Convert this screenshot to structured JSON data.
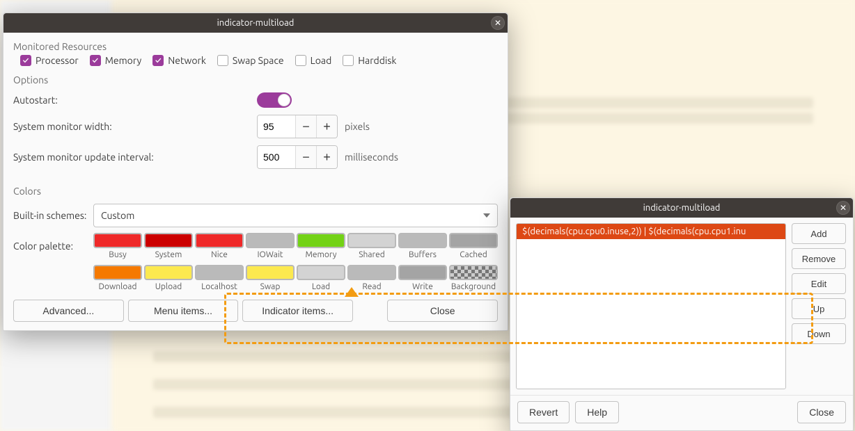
{
  "dialog1": {
    "title": "indicator-multiload",
    "sections": {
      "monitored": "Monitored Resources",
      "options": "Options",
      "colors": "Colors"
    },
    "checkboxes": [
      {
        "label": "Processor",
        "checked": true
      },
      {
        "label": "Memory",
        "checked": true
      },
      {
        "label": "Network",
        "checked": true
      },
      {
        "label": "Swap Space",
        "checked": false
      },
      {
        "label": "Load",
        "checked": false
      },
      {
        "label": "Harddisk",
        "checked": false
      }
    ],
    "options": {
      "autostart_label": "Autostart:",
      "autostart_on": true,
      "width_label": "System monitor width:",
      "width_value": "95",
      "width_unit": "pixels",
      "interval_label": "System monitor update interval:",
      "interval_value": "500",
      "interval_unit": "milliseconds"
    },
    "colors": {
      "schemes_label": "Built-in schemes:",
      "schemes_value": "Custom",
      "palette_label": "Color palette:",
      "row1": [
        {
          "label": "Busy",
          "color": "#ef2929"
        },
        {
          "label": "System",
          "color": "#cc0000"
        },
        {
          "label": "Nice",
          "color": "#ef2929"
        },
        {
          "label": "IOWait",
          "color": "#bababa"
        },
        {
          "label": "Memory",
          "color": "#73d216"
        },
        {
          "label": "Shared",
          "color": "#d3d3d3"
        },
        {
          "label": "Buffers",
          "color": "#bababa"
        },
        {
          "label": "Cached",
          "color": "#a4a4a4"
        }
      ],
      "row2": [
        {
          "label": "Download",
          "color": "#f57900"
        },
        {
          "label": "Upload",
          "color": "#fce94f"
        },
        {
          "label": "Localhost",
          "color": "#bababa"
        },
        {
          "label": "Swap",
          "color": "#fce94f"
        },
        {
          "label": "Load",
          "color": "#d3d3d3"
        },
        {
          "label": "Read",
          "color": "#bababa"
        },
        {
          "label": "Write",
          "color": "#a4a4a4"
        },
        {
          "label": "Background",
          "color": "checker"
        }
      ]
    },
    "footer": {
      "advanced": "Advanced...",
      "menu": "Menu items...",
      "indicator": "Indicator items...",
      "close": "Close"
    }
  },
  "dialog2": {
    "title": "indicator-multiload",
    "list_item": "$(decimals(cpu.cpu0.inuse,2)) | $(decimals(cpu.cpu1.inu",
    "buttons": {
      "add": "Add",
      "remove": "Remove",
      "edit": "Edit",
      "up": "Up",
      "down": "Down",
      "revert": "Revert",
      "help": "Help",
      "close": "Close"
    }
  }
}
